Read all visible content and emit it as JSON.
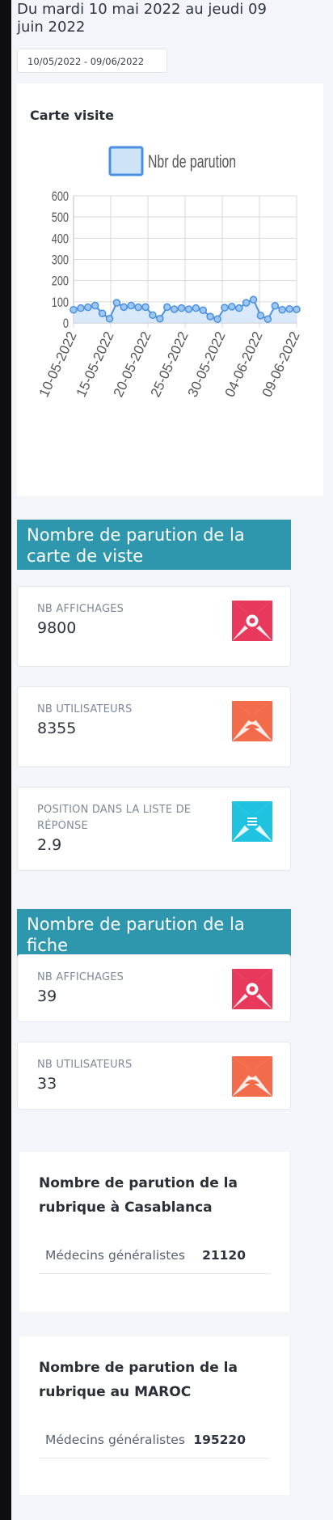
{
  "header": {
    "range_text": "Du mardi 10 mai 2022 au jeudi 09 juin 2022",
    "date_input": "10/05/2022 - 09/06/2022"
  },
  "chart_card": {
    "title": "Carte visite"
  },
  "chart_data": {
    "type": "area",
    "title": "",
    "xlabel": "",
    "ylabel": "",
    "ylim": [
      0,
      600
    ],
    "yticks": [
      "600",
      "500",
      "400",
      "300",
      "200",
      "100",
      "0"
    ],
    "xticks": [
      "10-05-2022",
      "15-05-2022",
      "20-05-2022",
      "25-05-2022",
      "30-05-2022",
      "04-06-2022",
      "09-06-2022"
    ],
    "grid": true,
    "legend": "top",
    "series": [
      {
        "name": "Nbr de parution",
        "color": "#4a90e2",
        "fill": "#cfe3f7",
        "values": [
          62,
          70,
          74,
          82,
          45,
          20,
          95,
          75,
          82,
          74,
          75,
          37,
          20,
          75,
          65,
          70,
          65,
          70,
          60,
          30,
          18,
          72,
          77,
          70,
          95,
          110,
          35,
          18,
          81,
          62,
          66,
          64
        ]
      }
    ]
  },
  "section_carte": {
    "title": "Nombre de parution de la carte de viste",
    "cards": [
      {
        "label": "NB AFFICHAGES",
        "value": "9800",
        "icon": "eye-icon",
        "color": "#e8395c"
      },
      {
        "label": "NB UTILISATEURS",
        "value": "8355",
        "icon": "users-icon",
        "color": "#f26b4b"
      },
      {
        "label": "POSITION DANS LA LISTE DE RÉPONSE",
        "value": "2.9",
        "icon": "list-icon",
        "color": "#1fc3e0"
      }
    ]
  },
  "section_fiche": {
    "title": "Nombre de parution de la fiche",
    "cards": [
      {
        "label": "NB AFFICHAGES",
        "value": "39",
        "icon": "eye-icon",
        "color": "#e8395c"
      },
      {
        "label": "NB UTILISATEURS",
        "value": "33",
        "icon": "users-icon",
        "color": "#f26b4b"
      }
    ]
  },
  "rubrique_casablanca": {
    "title": "Nombre de parution de la rubrique à Casablanca",
    "rows": [
      {
        "label": "Médecins généralistes",
        "value": "21120"
      }
    ]
  },
  "rubrique_maroc": {
    "title": "Nombre de parution de la rubrique au MAROC",
    "rows": [
      {
        "label": "Médecins généralistes",
        "value": "195220"
      }
    ]
  }
}
